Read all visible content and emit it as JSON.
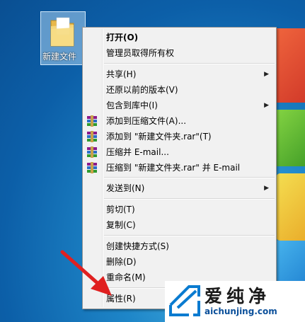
{
  "desktop": {
    "folder_label": "新建文件"
  },
  "menu": {
    "items": [
      {
        "label": "打开(O)",
        "bold": true,
        "arrow": false,
        "icon": ""
      },
      {
        "label": "管理员取得所有权",
        "arrow": false,
        "icon": ""
      },
      {
        "label": "共享(H)",
        "arrow": true,
        "icon": ""
      },
      {
        "label": "还原以前的版本(V)",
        "arrow": false,
        "icon": ""
      },
      {
        "label": "包含到库中(I)",
        "arrow": true,
        "icon": ""
      },
      {
        "label": "添加到压缩文件(A)...",
        "arrow": false,
        "icon": "winrar-icon"
      },
      {
        "label": "添加到 \"新建文件夹.rar\"(T)",
        "arrow": false,
        "icon": "winrar-icon"
      },
      {
        "label": "压缩并 E-mail...",
        "arrow": false,
        "icon": "winrar-icon"
      },
      {
        "label": "压缩到 \"新建文件夹.rar\" 并 E-mail",
        "arrow": false,
        "icon": "winrar-icon"
      },
      {
        "label": "发送到(N)",
        "arrow": true,
        "icon": ""
      },
      {
        "label": "剪切(T)",
        "arrow": false,
        "icon": ""
      },
      {
        "label": "复制(C)",
        "arrow": false,
        "icon": ""
      },
      {
        "label": "创建快捷方式(S)",
        "arrow": false,
        "icon": ""
      },
      {
        "label": "删除(D)",
        "arrow": false,
        "icon": ""
      },
      {
        "label": "重命名(M)",
        "arrow": false,
        "icon": ""
      },
      {
        "label": "属性(R)",
        "arrow": false,
        "icon": ""
      }
    ],
    "arrow_glyph": "▶"
  },
  "watermark": {
    "title": "爱纯净",
    "url": "aichunjing.com"
  },
  "colors": {
    "annotation_arrow": "#e02020"
  }
}
